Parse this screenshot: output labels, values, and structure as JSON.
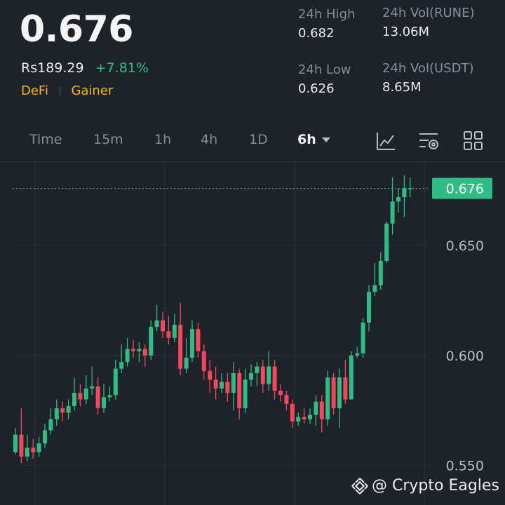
{
  "header": {
    "price": "0.676",
    "fiat_price": "Rs189.29",
    "change": "+7.81%",
    "tags": [
      "DeFi",
      "Gainer"
    ]
  },
  "stats": {
    "high_label": "24h High",
    "high_value": "0.682",
    "low_label": "24h Low",
    "low_value": "0.626",
    "vol_base_label": "24h Vol(RUNE)",
    "vol_base_value": "13.06M",
    "vol_quote_label": "24h Vol(USDT)",
    "vol_quote_value": "8.65M"
  },
  "toolbar": {
    "timeframes": [
      "Time",
      "15m",
      "1h",
      "4h",
      "1D",
      "6h"
    ],
    "active": "6h",
    "icons": [
      "indicator-icon",
      "settings-icon",
      "layout-grid-icon"
    ]
  },
  "colors": {
    "up": "#2ebd85",
    "down": "#f6465d",
    "accent": "#f0b90b"
  },
  "watermark": "@ Crypto Eagles",
  "chart_data": {
    "type": "candlestick",
    "ylim": [
      0.532,
      0.688
    ],
    "y_ticks": [
      "0.650",
      "0.600",
      "0.550"
    ],
    "last_price": "0.676",
    "candles": [
      [
        0.556,
        0.564,
        0.567,
        0.555
      ],
      [
        0.564,
        0.554,
        0.576,
        0.551
      ],
      [
        0.554,
        0.558,
        0.564,
        0.552
      ],
      [
        0.558,
        0.556,
        0.562,
        0.553
      ],
      [
        0.556,
        0.56,
        0.563,
        0.554
      ],
      [
        0.56,
        0.566,
        0.569,
        0.558
      ],
      [
        0.566,
        0.571,
        0.576,
        0.564
      ],
      [
        0.571,
        0.576,
        0.58,
        0.568
      ],
      [
        0.576,
        0.574,
        0.579,
        0.57
      ],
      [
        0.574,
        0.577,
        0.58,
        0.571
      ],
      [
        0.577,
        0.583,
        0.59,
        0.575
      ],
      [
        0.583,
        0.58,
        0.587,
        0.577
      ],
      [
        0.58,
        0.585,
        0.591,
        0.578
      ],
      [
        0.585,
        0.586,
        0.595,
        0.582
      ],
      [
        0.586,
        0.576,
        0.59,
        0.573
      ],
      [
        0.576,
        0.581,
        0.587,
        0.574
      ],
      [
        0.581,
        0.582,
        0.586,
        0.579
      ],
      [
        0.582,
        0.594,
        0.598,
        0.58
      ],
      [
        0.594,
        0.597,
        0.605,
        0.592
      ],
      [
        0.597,
        0.603,
        0.608,
        0.595
      ],
      [
        0.603,
        0.602,
        0.607,
        0.599
      ],
      [
        0.602,
        0.603,
        0.606,
        0.597
      ],
      [
        0.603,
        0.6,
        0.605,
        0.595
      ],
      [
        0.6,
        0.613,
        0.616,
        0.598
      ],
      [
        0.613,
        0.616,
        0.623,
        0.611
      ],
      [
        0.616,
        0.611,
        0.62,
        0.608
      ],
      [
        0.611,
        0.608,
        0.618,
        0.605
      ],
      [
        0.608,
        0.614,
        0.619,
        0.606
      ],
      [
        0.614,
        0.594,
        0.624,
        0.591
      ],
      [
        0.594,
        0.599,
        0.608,
        0.592
      ],
      [
        0.599,
        0.612,
        0.616,
        0.597
      ],
      [
        0.612,
        0.602,
        0.615,
        0.599
      ],
      [
        0.602,
        0.593,
        0.605,
        0.589
      ],
      [
        0.593,
        0.589,
        0.598,
        0.583
      ],
      [
        0.589,
        0.585,
        0.595,
        0.58
      ],
      [
        0.585,
        0.588,
        0.592,
        0.583
      ],
      [
        0.588,
        0.583,
        0.592,
        0.579
      ],
      [
        0.583,
        0.592,
        0.597,
        0.575
      ],
      [
        0.592,
        0.576,
        0.594,
        0.571
      ],
      [
        0.576,
        0.589,
        0.594,
        0.574
      ],
      [
        0.589,
        0.592,
        0.596,
        0.586
      ],
      [
        0.592,
        0.595,
        0.597,
        0.586
      ],
      [
        0.595,
        0.587,
        0.598,
        0.583
      ],
      [
        0.587,
        0.595,
        0.602,
        0.584
      ],
      [
        0.595,
        0.584,
        0.598,
        0.58
      ],
      [
        0.584,
        0.582,
        0.587,
        0.579
      ],
      [
        0.582,
        0.578,
        0.584,
        0.575
      ],
      [
        0.578,
        0.57,
        0.58,
        0.567
      ],
      [
        0.57,
        0.572,
        0.574,
        0.568
      ],
      [
        0.572,
        0.571,
        0.576,
        0.569
      ],
      [
        0.571,
        0.573,
        0.576,
        0.569
      ],
      [
        0.573,
        0.579,
        0.582,
        0.568
      ],
      [
        0.579,
        0.571,
        0.582,
        0.565
      ],
      [
        0.571,
        0.59,
        0.593,
        0.568
      ],
      [
        0.59,
        0.576,
        0.592,
        0.573
      ],
      [
        0.576,
        0.59,
        0.594,
        0.567
      ],
      [
        0.59,
        0.58,
        0.598,
        0.578
      ],
      [
        0.58,
        0.6,
        0.602,
        0.58
      ],
      [
        0.6,
        0.601,
        0.604,
        0.599
      ],
      [
        0.601,
        0.615,
        0.617,
        0.599
      ],
      [
        0.615,
        0.629,
        0.632,
        0.611
      ],
      [
        0.629,
        0.632,
        0.642,
        0.627
      ],
      [
        0.632,
        0.643,
        0.647,
        0.63
      ],
      [
        0.643,
        0.66,
        0.661,
        0.642
      ],
      [
        0.66,
        0.67,
        0.681,
        0.655
      ],
      [
        0.67,
        0.672,
        0.676,
        0.665
      ],
      [
        0.672,
        0.676,
        0.682,
        0.663
      ],
      [
        0.676,
        0.676,
        0.681,
        0.672
      ]
    ]
  }
}
